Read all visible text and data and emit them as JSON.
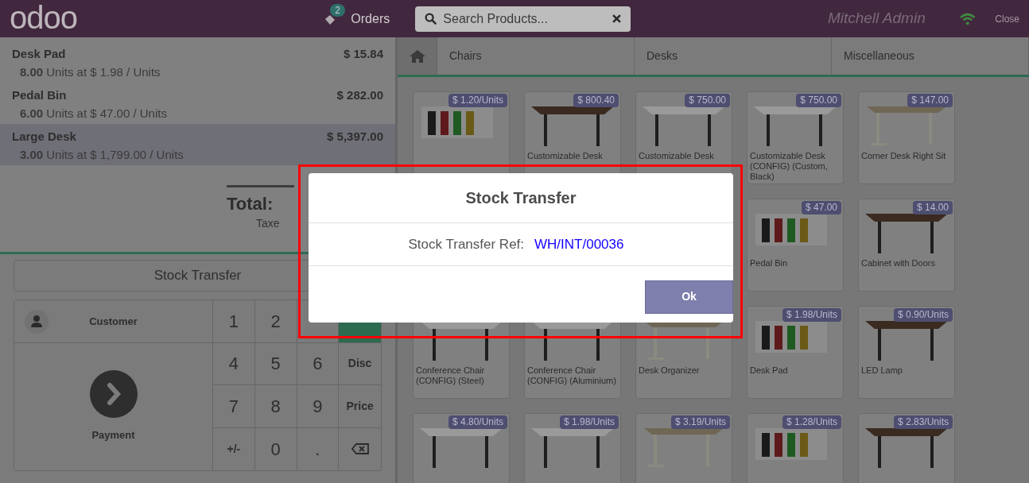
{
  "header": {
    "logo": "odoo",
    "orders_count": "2",
    "orders_label": "Orders",
    "search": {
      "placeholder": "Search Products..."
    },
    "user": "Mitchell Admin",
    "close": "Close"
  },
  "order_lines": [
    {
      "name": "Desk Pad",
      "price": "$ 15.84",
      "qty": "8.00",
      "detail": "Units at $ 1.98 / Units",
      "selected": false
    },
    {
      "name": "Pedal Bin",
      "price": "$ 282.00",
      "qty": "6.00",
      "detail": "Units at $ 47.00 / Units",
      "selected": false
    },
    {
      "name": "Large Desk",
      "price": "$ 5,397.00",
      "qty": "3.00",
      "detail": "Units at $ 1,799.00 / Units",
      "selected": true
    }
  ],
  "totals": {
    "label": "Total:",
    "taxes": "Taxe"
  },
  "stock_transfer_button": "Stock Transfer",
  "customer_button": "Customer",
  "payment_button": "Payment",
  "keypad": [
    [
      {
        "label": "1",
        "selected": false
      },
      {
        "label": "2",
        "selected": false
      },
      {
        "selected": false
      },
      {
        "selected": true
      }
    ],
    [
      {
        "label": "4",
        "selected": false
      },
      {
        "label": "5",
        "selected": false
      },
      {
        "label": "6",
        "selected": false
      },
      {
        "label": "Disc",
        "selected": false
      }
    ],
    [
      {
        "label": "7",
        "selected": false
      },
      {
        "label": "8",
        "selected": false
      },
      {
        "label": "9",
        "selected": false
      },
      {
        "label": "Price",
        "selected": false
      }
    ],
    [
      {
        "label": "+/-",
        "selected": false
      },
      {
        "label": "0",
        "selected": false
      },
      {
        "label": ".",
        "selected": false
      },
      {
        "kind": "backspace",
        "selected": false
      }
    ]
  ],
  "categories": [
    "Chairs",
    "Desks",
    "Miscellaneous"
  ],
  "product_rows": [
    [
      {
        "kind": "picture",
        "price": "$ 1.20/Units"
      },
      {
        "kind": "picture",
        "price": "$ 800.40",
        "name": "Customizable Desk"
      },
      {
        "kind": "picture",
        "price": "$ 750.00",
        "name": "Customizable Desk"
      },
      {
        "kind": "picture",
        "price": "$ 750.00",
        "name": "Customizable Desk (CONFIG) (Custom, Black)"
      },
      {
        "kind": "picture",
        "price": "$ 147.00",
        "name": "Corner Desk Right Sit"
      }
    ],
    [
      {
        "kind": "picture",
        "price": "$ 47.00",
        "name": "Pedal Bin"
      },
      {
        "kind": "picture",
        "price": "$ 14.00",
        "name": "Cabinet with Doors"
      }
    ],
    [
      {
        "kind": "picture",
        "name": "Conference Chair (CONFIG) (Steel)"
      },
      {
        "kind": "picture",
        "name": "Conference Chair (CONFIG) (Aluminium)"
      },
      {
        "kind": "picture",
        "name": "Desk Organizer"
      },
      {
        "kind": "picture",
        "price": "$ 1.98/Units",
        "name": "Desk Pad"
      },
      {
        "kind": "picture",
        "price": "$ 0.90/Units",
        "name": "LED Lamp"
      }
    ],
    [
      {
        "kind": "picture",
        "price": "$ 4.80/Units"
      },
      {
        "kind": "picture",
        "price": "$ 1.98/Units"
      },
      {
        "kind": "picture",
        "price": "$ 3.19/Units"
      },
      {
        "kind": "picture",
        "price": "$ 1.28/Units"
      },
      {
        "kind": "picture",
        "price": "$ 2.83/Units"
      }
    ]
  ],
  "dialog": {
    "title": "Stock Transfer",
    "ref_label": "Stock Transfer Ref:",
    "ref": "WH/INT/00036",
    "button": "Ok"
  }
}
